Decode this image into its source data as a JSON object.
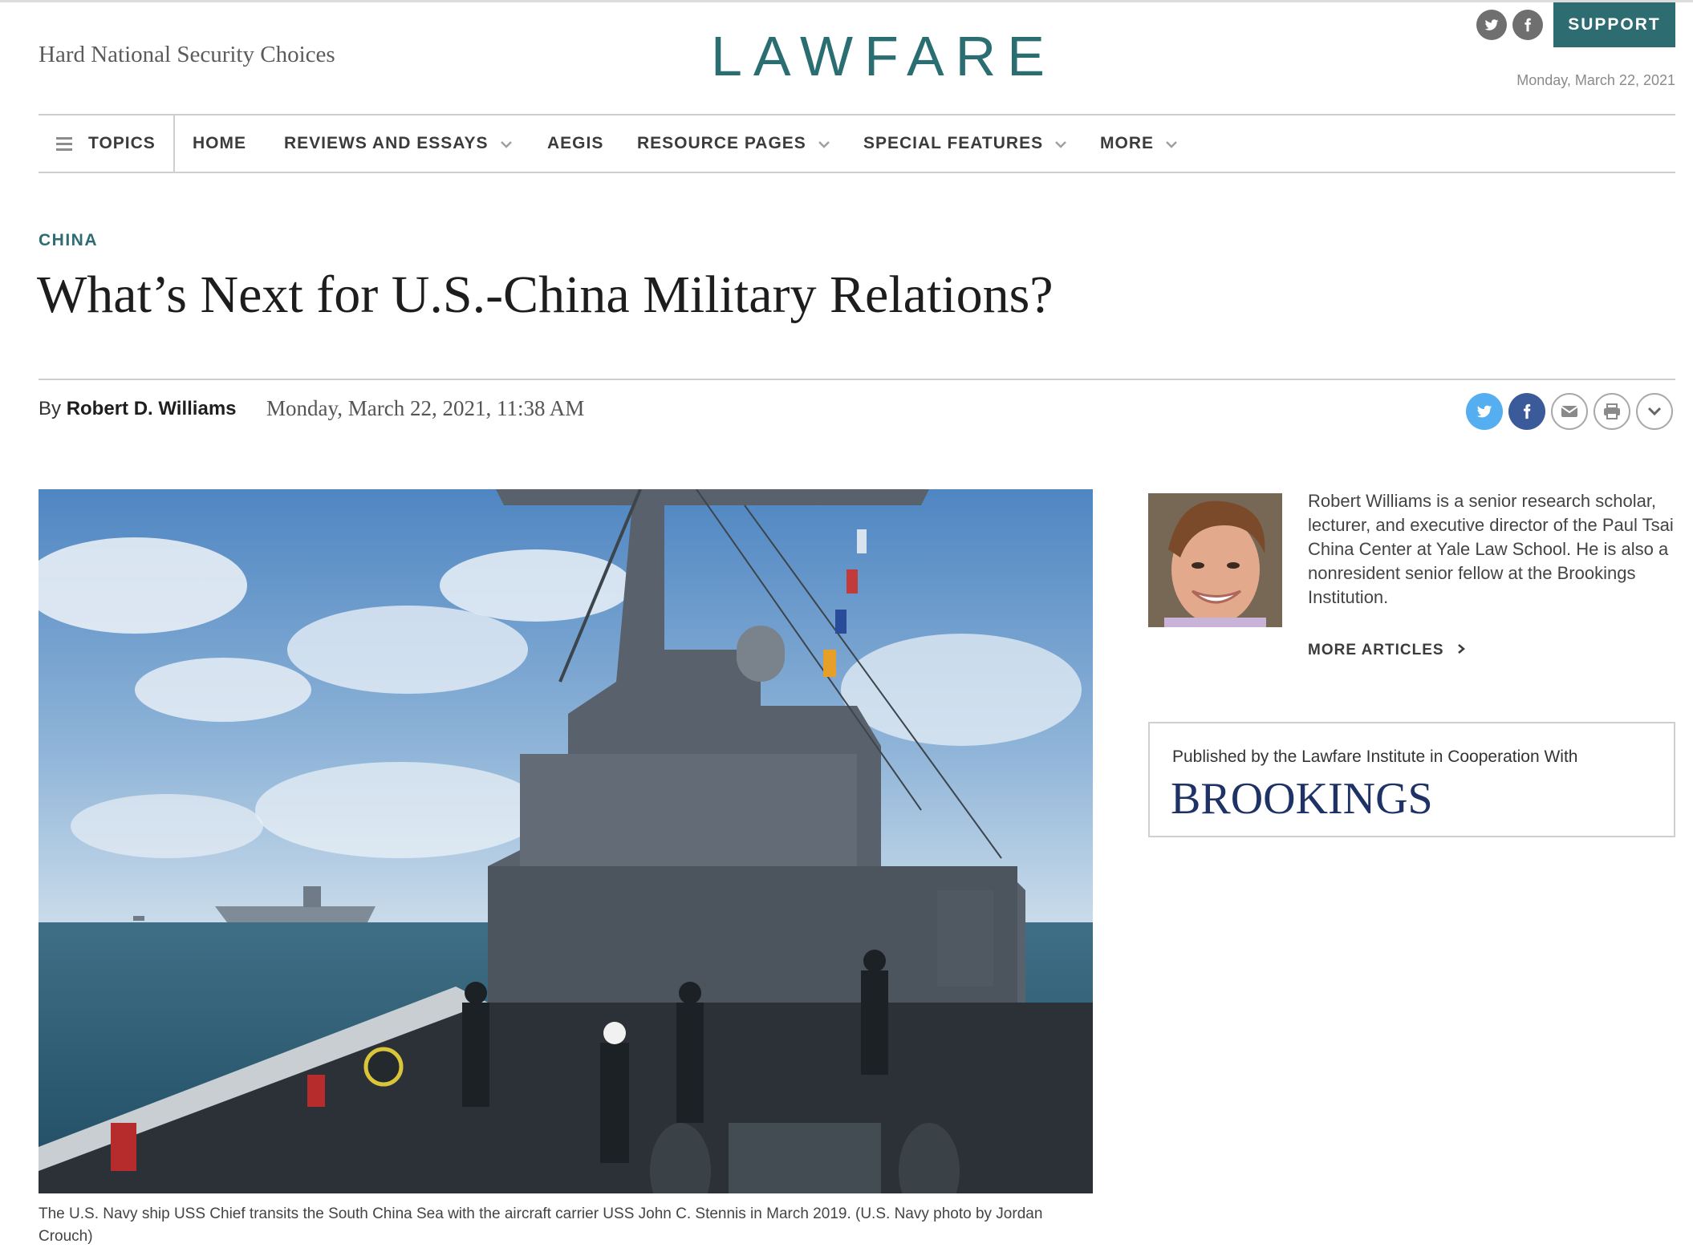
{
  "header": {
    "tagline": "Hard National Security Choices",
    "logo": "LAWFARE",
    "support_label": "SUPPORT",
    "date": "Monday, March 22, 2021",
    "social": [
      "twitter-icon",
      "facebook-icon"
    ]
  },
  "nav": {
    "items": [
      {
        "label": "TOPICS",
        "icon": "hamburger-icon"
      },
      {
        "label": "HOME"
      },
      {
        "label": "REVIEWS AND ESSAYS",
        "dropdown": true
      },
      {
        "label": "AEGIS"
      },
      {
        "label": "RESOURCE PAGES",
        "dropdown": true
      },
      {
        "label": "SPECIAL FEATURES",
        "dropdown": true
      },
      {
        "label": "MORE",
        "dropdown": true
      }
    ]
  },
  "article": {
    "kicker": "CHINA",
    "title": "What’s Next for U.S.-China Military Relations?",
    "by_prefix": "By",
    "author": "Robert D. Williams",
    "date": "Monday, March 22, 2021, 11:38 AM",
    "share_icons": [
      "twitter-icon",
      "facebook-icon",
      "email-icon",
      "print-icon",
      "chevron-down-icon"
    ],
    "caption": "The U.S. Navy ship USS Chief transits the South China Sea with the aircraft carrier USS John C. Stennis in March 2019. (U.S. Navy photo by Jordan Crouch)"
  },
  "sidebar": {
    "bio": "Robert Williams is a senior research scholar, lecturer, and executive director of the Paul Tsai China Center at Yale Law School. He is also a nonresident senior fellow at the Brookings Institution.",
    "more_articles": "MORE ARTICLES",
    "published_line": "Published by the Lawfare Institute in Cooperation With",
    "partner": "BROOKINGS"
  },
  "colors": {
    "brand": "#2b6e72",
    "support_bg": "#2d6c71",
    "twitter": "#55aef0",
    "facebook": "#3b5a9a",
    "brookings": "#1f3266"
  }
}
